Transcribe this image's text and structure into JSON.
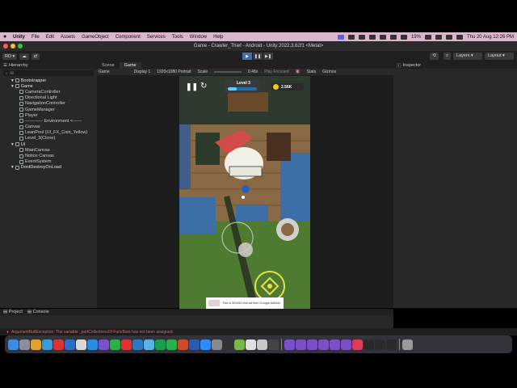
{
  "menubar": {
    "app_name": "Unity",
    "items": [
      "File",
      "Edit",
      "Assets",
      "GameObject",
      "Component",
      "Services",
      "Tools",
      "Window",
      "Help"
    ],
    "battery": "19%",
    "clock": "Thu 20 Aug  12:26 PM"
  },
  "window": {
    "title": "Game - Crawler_Thief - Android - Unity 2022.3.62f1 <Metal>"
  },
  "toolbar": {
    "account_label": "RD",
    "layers_label": "Layers",
    "layout_label": "Layout"
  },
  "hierarchy": {
    "tab_label": "Hierarchy",
    "search_placeholder": "All",
    "rows": [
      {
        "label": "Bootstrapper",
        "indent": 1,
        "scene": true
      },
      {
        "label": "Game",
        "indent": 1,
        "scene": true
      },
      {
        "label": "CameraController",
        "indent": 2,
        "scene": false
      },
      {
        "label": "Directional Light",
        "indent": 2,
        "scene": false
      },
      {
        "label": "NavigationController",
        "indent": 2,
        "scene": false
      },
      {
        "label": "GameManager",
        "indent": 2,
        "scene": false
      },
      {
        "label": "Player",
        "indent": 2,
        "scene": false
      },
      {
        "label": "------------ Environment <------",
        "indent": 2,
        "scene": false
      },
      {
        "label": "Canvas",
        "indent": 2,
        "scene": false
      },
      {
        "label": "LeanPool (UI_FX_Coin_Yellow)",
        "indent": 2,
        "scene": false
      },
      {
        "label": "Level_3(Clone)",
        "indent": 2,
        "scene": false
      },
      {
        "label": "UI",
        "indent": 1,
        "scene": true
      },
      {
        "label": "MainCanvas",
        "indent": 2,
        "scene": false
      },
      {
        "label": "Notice Canvas",
        "indent": 2,
        "scene": false
      },
      {
        "label": "EventSystem",
        "indent": 2,
        "scene": false
      },
      {
        "label": "DontDestroyOnLoad",
        "indent": 1,
        "scene": true
      }
    ]
  },
  "center": {
    "tabs": [
      "Scene",
      "Game"
    ],
    "game_bar": {
      "display_mode": "Game",
      "display": "Display 1",
      "resolution": "1920x1080 Portrait",
      "scale_label": "Scale",
      "scale_value": "0.48x",
      "play_focus": "Play Focused",
      "stats": "Stats",
      "gizmos": "Gizmos"
    }
  },
  "game": {
    "level_label": "Level 3",
    "coins": "2.56K",
    "ad_text": "This is 320x50 test ad from Google AdMob"
  },
  "inspector": {
    "tab_label": "Inspector"
  },
  "bottom": {
    "tabs": [
      "Project",
      "Console"
    ]
  },
  "status": {
    "message": "ArgumentNullException: The variable _partCollectionsOf FuncBars has not been assigned."
  },
  "dock": {
    "icons": [
      {
        "name": "finder-icon",
        "color": "#3c8de0"
      },
      {
        "name": "launchpad-icon",
        "color": "#8c8c9c"
      },
      {
        "name": "chrome-icon",
        "color": "#e0a030"
      },
      {
        "name": "safari-icon",
        "color": "#3b9bd9"
      },
      {
        "name": "redstar-icon",
        "color": "#d33"
      },
      {
        "name": "vpn-icon",
        "color": "#2a6dc4"
      },
      {
        "name": "chrome-alt-icon",
        "color": "#d8d8d8"
      },
      {
        "name": "vscode-icon",
        "color": "#2b8de0"
      },
      {
        "name": "visual-studio-icon",
        "color": "#7a4fc8"
      },
      {
        "name": "whatsapp-icon",
        "color": "#2ab049"
      },
      {
        "name": "mail-icon",
        "color": "#d33"
      },
      {
        "name": "mp3-icon",
        "color": "#2a7ac4"
      },
      {
        "name": "folder-icon",
        "color": "#5ab1e6"
      },
      {
        "name": "spreadsheet-icon",
        "color": "#1b9e4b"
      },
      {
        "name": "facetime-icon",
        "color": "#28b14c"
      },
      {
        "name": "powerpoint-icon",
        "color": "#d04a2a"
      },
      {
        "name": "word-icon",
        "color": "#2a5caa"
      },
      {
        "name": "zoom-icon",
        "color": "#2d8cff"
      },
      {
        "name": "app-store-icon",
        "color": "#8a8a8a"
      },
      {
        "name": "unity-hub-icon",
        "color": "#333"
      },
      {
        "name": "android-icon",
        "color": "#7ab648"
      },
      {
        "name": "notes-icon",
        "color": "#e0e0e0"
      },
      {
        "name": "photos-icon",
        "color": "#c8c8c8"
      },
      {
        "name": "github-icon",
        "color": "#444"
      },
      {
        "name": "vs-icon-2",
        "color": "#7a4fc8"
      },
      {
        "name": "vs-icon-3",
        "color": "#7a4fc8"
      },
      {
        "name": "vs-icon-4",
        "color": "#7a4fc8"
      },
      {
        "name": "vs-icon-5",
        "color": "#7a4fc8"
      },
      {
        "name": "vs-icon-6",
        "color": "#7a4fc8"
      },
      {
        "name": "vs-icon-7",
        "color": "#7a4fc8"
      },
      {
        "name": "music-icon",
        "color": "#e03a5a"
      },
      {
        "name": "unity-icon",
        "color": "#2a2a2a"
      },
      {
        "name": "unity-icon-2",
        "color": "#2a2a2a"
      },
      {
        "name": "unity-icon-3",
        "color": "#2a2a2a"
      },
      {
        "name": "trash-icon",
        "color": "#9a9a9a"
      }
    ]
  }
}
